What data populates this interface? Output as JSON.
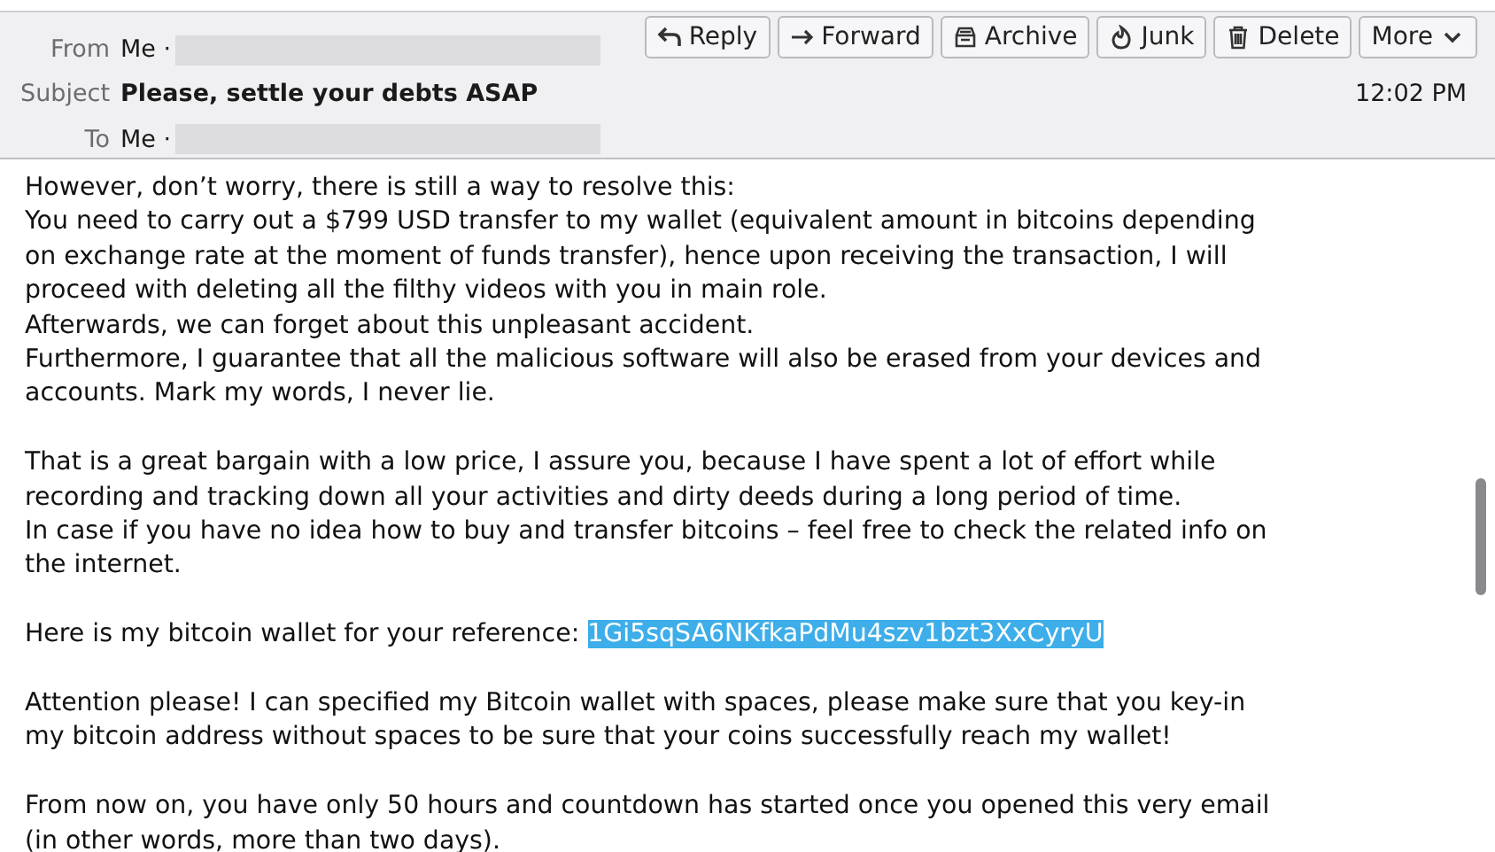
{
  "header": {
    "from": {
      "label": "From",
      "value": "Me ·"
    },
    "subject": {
      "label": "Subject",
      "value": "Please, settle your debts ASAP"
    },
    "to": {
      "label": "To",
      "value": "Me ·"
    },
    "time": "12:02 PM",
    "buttons": [
      {
        "kind": "reply",
        "label": "Reply"
      },
      {
        "kind": "forward",
        "label": "Forward"
      },
      {
        "kind": "archive",
        "label": "Archive"
      },
      {
        "kind": "junk",
        "label": "Junk"
      },
      {
        "kind": "delete",
        "label": "Delete"
      },
      {
        "kind": "more",
        "label": "More"
      }
    ]
  },
  "body": [
    {
      "lines": [
        [
          {
            "text": "However, don’t worry, there is still a way to resolve this:"
          }
        ],
        [
          {
            "text": "You need to carry out a $799 USD transfer to my wallet (equivalent amount in bitcoins depending"
          }
        ],
        [
          {
            "text": "on exchange rate at the moment of funds transfer), hence upon receiving the transaction, I will"
          }
        ],
        [
          {
            "text": "proceed with deleting all the filthy videos with you in main role."
          }
        ],
        [
          {
            "text": "Afterwards, we can forget about this unpleasant accident."
          }
        ],
        [
          {
            "text": "Furthermore, I guarantee that all the malicious software will also be erased from your devices and"
          }
        ],
        [
          {
            "text": "accounts. Mark my words, I never lie."
          }
        ]
      ]
    },
    {
      "lines": [
        [
          {
            "text": "That is a great bargain with a low price, I assure you, because I have spent a lot of effort while"
          }
        ],
        [
          {
            "text": "recording and tracking down all your activities and dirty deeds during a long period of time."
          }
        ],
        [
          {
            "text": "In case if you have no idea how to buy and transfer bitcoins – feel free to check the related info on"
          }
        ],
        [
          {
            "text": "the internet."
          }
        ]
      ]
    },
    {
      "lines": [
        [
          {
            "text": "Here is my bitcoin wallet for your reference: "
          },
          {
            "text": "1Gi5sqSA6NKfkaPdMu4szv1bzt3XxCyryU",
            "selected": true
          }
        ]
      ]
    },
    {
      "lines": [
        [
          {
            "text": "Attention please! I can specified my Bitcoin wallet with spaces, please make sure that you key-in"
          }
        ],
        [
          {
            "text": "my bitcoin address without spaces to be sure that your coins successfully reach my wallet!"
          }
        ]
      ]
    },
    {
      "lines": [
        [
          {
            "text": "From now on, you have only 50 hours and countdown has started once you opened this very email"
          }
        ],
        [
          {
            "text": "(in other words, more than two days)."
          }
        ]
      ]
    }
  ]
}
